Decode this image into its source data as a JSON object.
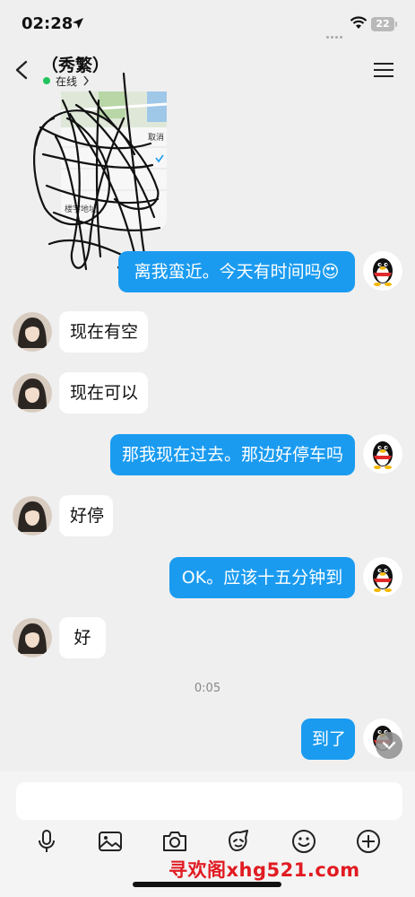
{
  "status_bar": {
    "time": "02:28",
    "battery": "22"
  },
  "header": {
    "contact_name": "（秀繁）",
    "status": "在线"
  },
  "map_card": {
    "cancel_label": "取消",
    "extra_label": "楼宇地址"
  },
  "messages": [
    {
      "side": "out",
      "text": "离我蛮近。今天有时间吗😍"
    },
    {
      "side": "in",
      "text": "现在有空"
    },
    {
      "side": "in",
      "text": "现在可以"
    },
    {
      "side": "out",
      "text": "那我现在过去。那边好停车吗"
    },
    {
      "side": "in",
      "text": "好停"
    },
    {
      "side": "out",
      "text": "OK。应该十五分钟到"
    },
    {
      "side": "in",
      "text": "好"
    },
    {
      "side": "out",
      "text": "到了"
    }
  ],
  "timestamp": "0:05",
  "composer": {
    "placeholder": ""
  },
  "toolbar_icons": [
    "microphone-icon",
    "image-icon",
    "camera-icon",
    "sticker-icon",
    "emoji-icon",
    "plus-icon"
  ],
  "watermark": "寻欢阁xhg521.com",
  "colors": {
    "outgoing_bubble": "#1a9bf0",
    "online_dot": "#21c45c",
    "background": "#efefef",
    "watermark": "#e11b22"
  }
}
